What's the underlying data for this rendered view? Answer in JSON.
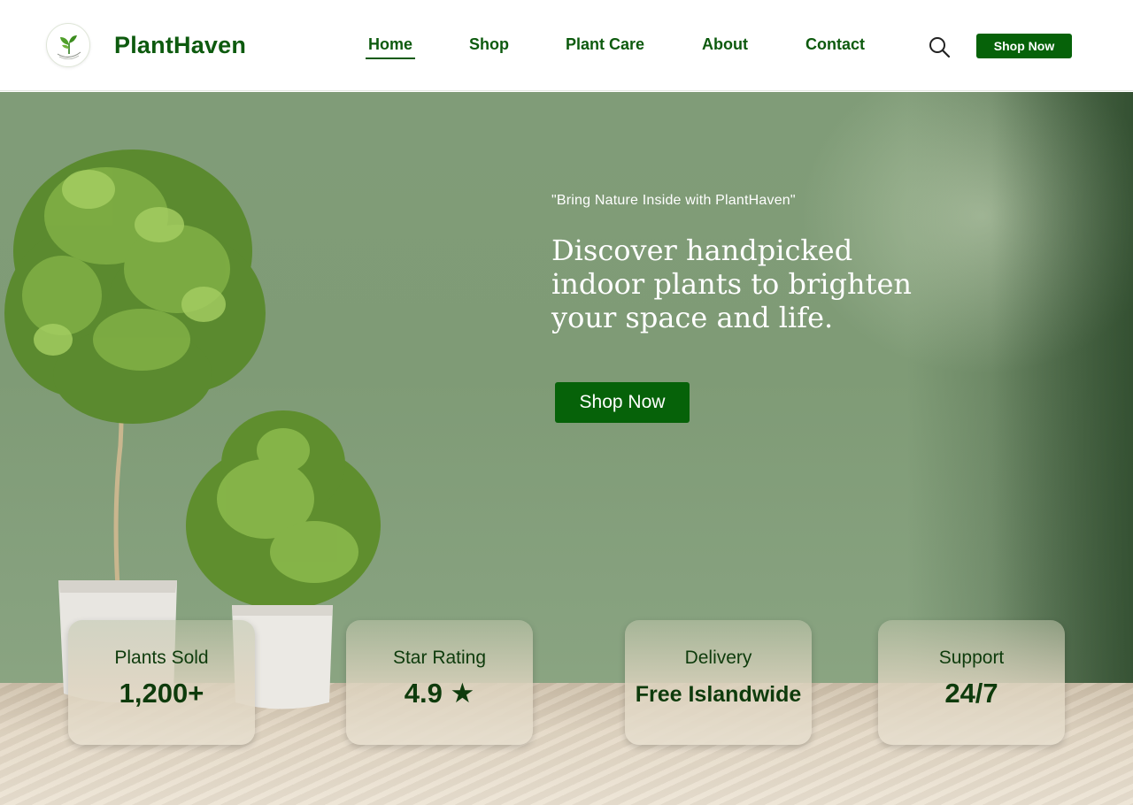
{
  "header": {
    "brand": "PlantHaven",
    "nav": [
      {
        "label": "Home",
        "active": true
      },
      {
        "label": "Shop",
        "active": false
      },
      {
        "label": "Plant Care",
        "active": false
      },
      {
        "label": "About",
        "active": false
      },
      {
        "label": "Contact",
        "active": false
      }
    ],
    "search_icon": "search-icon",
    "shop_button_label": "Shop Now"
  },
  "hero": {
    "tagline": "\"Bring Nature Inside with PlantHaven\"",
    "headline": "Discover handpicked indoor plants to brighten your space and life.",
    "cta_label": "Shop Now"
  },
  "stats": [
    {
      "label": "Plants Sold",
      "value": "1,200+"
    },
    {
      "label": "Star Rating",
      "value": "4.9 ★"
    },
    {
      "label": "Delivery",
      "value": "Free Islandwide"
    },
    {
      "label": "Support",
      "value": "24/7"
    }
  ],
  "colors": {
    "brand_green": "#0d5a0e",
    "button_green": "#066209",
    "hero_bg": "#809c78"
  }
}
